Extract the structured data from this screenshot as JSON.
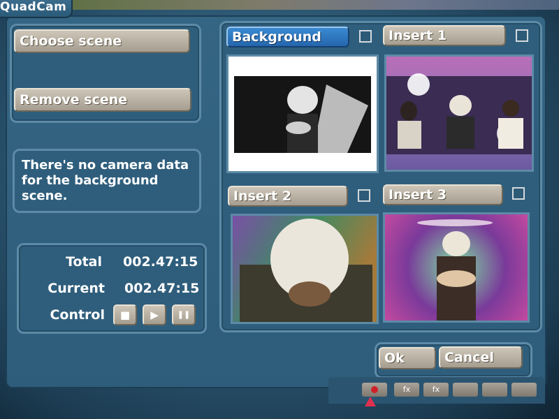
{
  "app": {
    "title": "QuadCam"
  },
  "scene_buttons": {
    "choose": "Choose scene",
    "remove": "Remove scene"
  },
  "message": "There's no camera data for the background scene.",
  "stats": {
    "total_label": "Total",
    "total_value": "002.47:15",
    "current_label": "Current",
    "current_value": "002.47:15",
    "control_label": "Control"
  },
  "controls": {
    "stop_icon": "■",
    "play_icon": "▶",
    "pause_icon": "❚❚"
  },
  "slots": [
    {
      "label": "Background",
      "selected": true,
      "checked": false
    },
    {
      "label": "Insert 1",
      "selected": false,
      "checked": false
    },
    {
      "label": "Insert 2",
      "selected": false,
      "checked": false
    },
    {
      "label": "Insert 3",
      "selected": false,
      "checked": false
    }
  ],
  "dialog_buttons": {
    "ok": "Ok",
    "cancel": "Cancel"
  },
  "taskbar": {
    "fx1": "fx",
    "fx2": "fx"
  },
  "colors": {
    "panel_bg": "#2f5e7c",
    "button_beige": "#b8b1a3",
    "selected_blue": "#2e78c0"
  }
}
